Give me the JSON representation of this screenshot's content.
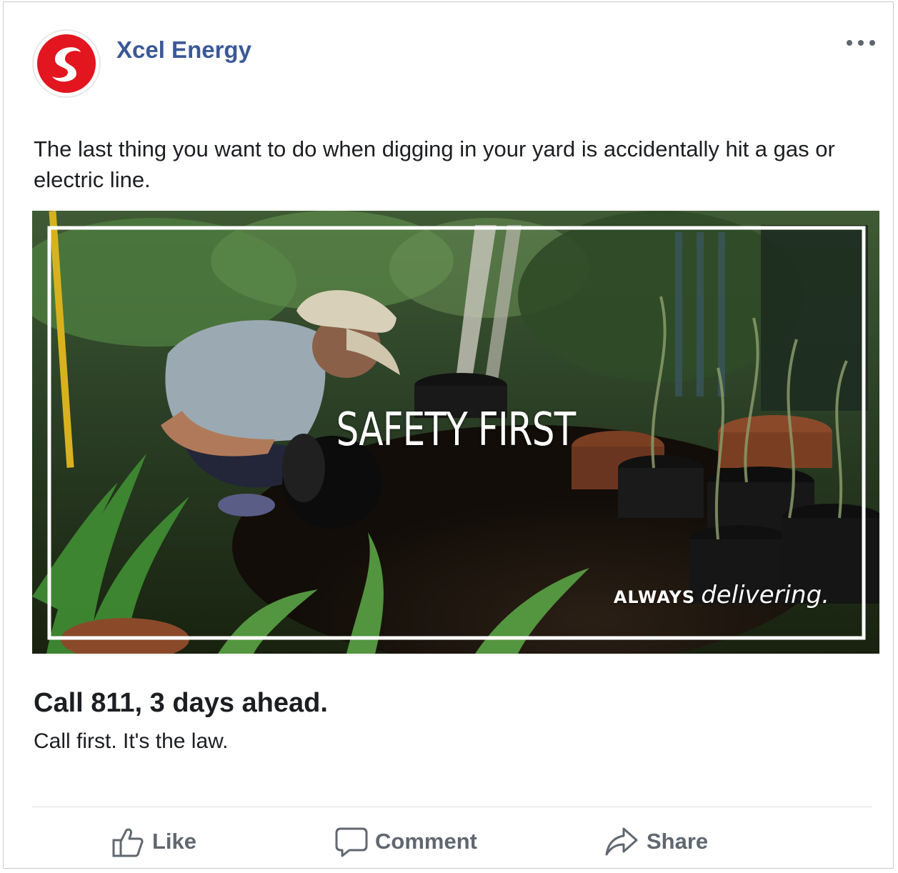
{
  "post": {
    "page_name": "Xcel Energy",
    "text": "The last thing you want to do when digging in your yard is accidentally hit a gas or electric line.",
    "more_icon": "more-options-icon",
    "media": {
      "overlay_title": "SAFETY FIRST",
      "tagline_prefix": "ALWAYS",
      "tagline_suffix": "delivering.",
      "frame_color": "#ffffff"
    },
    "link": {
      "title": "Call 811, 3 days ahead.",
      "description": "Call first. It's the law."
    },
    "actions": [
      {
        "label": "Like",
        "icon": "thumbs-up-icon"
      },
      {
        "label": "Comment",
        "icon": "speech-bubble-icon"
      },
      {
        "label": "Share",
        "icon": "share-arrow-icon"
      }
    ]
  },
  "colors": {
    "brand_name": "#3b5998",
    "logo_red": "#e3151e",
    "action_gray": "#606770"
  }
}
